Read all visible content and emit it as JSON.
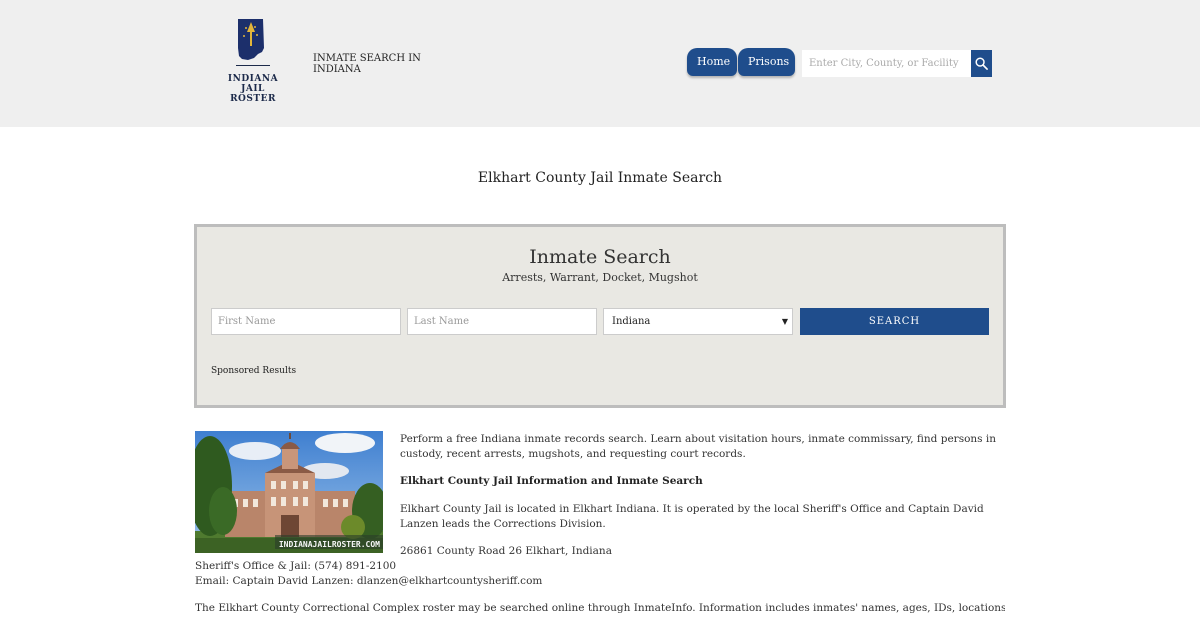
{
  "header": {
    "logo_line1": "INDIANA",
    "logo_line2": "JAIL ROSTER",
    "tagline": "INMATE SEARCH IN INDIANA",
    "nav": [
      {
        "label": "Home"
      },
      {
        "label": "Prisons"
      }
    ],
    "search_placeholder": "Enter City, County, or Facility",
    "search_icon": "magnifier-icon"
  },
  "page_title": "Elkhart County Jail Inmate Search",
  "panel": {
    "title": "Inmate Search",
    "subtitle": "Arrests, Warrant, Docket, Mugshot",
    "first_name_placeholder": "First Name",
    "last_name_placeholder": "Last Name",
    "state_selected": "Indiana",
    "search_label": "SEARCH",
    "sponsored": "Sponsored Results"
  },
  "content": {
    "photo_watermark": "INDIANAJAILROSTER.COM",
    "intro": "Perform a free Indiana inmate records search. Learn about visitation hours, inmate commissary, find persons in custody, recent arrests, mugshots, and requesting court records.",
    "info_heading": "Elkhart County Jail Information and Inmate Search",
    "located": "Elkhart County Jail is located in Elkhart Indiana. It is operated by the local Sheriff's Office and Captain David Lanzen leads the Corrections Division.",
    "address": "26861 County Road 26 Elkhart, Indiana",
    "phone": "Sheriff's Office & Jail: (574) 891-2100",
    "email": "Email: Captain David Lanzen: dlanzen@elkhartcountysheriff.com",
    "roster": "The Elkhart County Correctional Complex roster may be searched online through InmateInfo. Information includes inmates' names, ages, IDs, locations, and charging, bail,"
  },
  "colors": {
    "header_bg": "#efefef",
    "accent_blue": "#1f4d8c",
    "panel_bg": "#e9e8e3"
  }
}
